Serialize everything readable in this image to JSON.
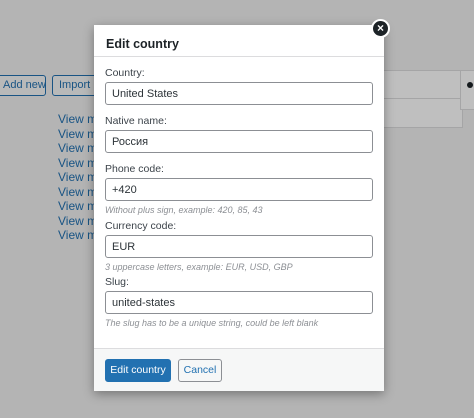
{
  "background": {
    "buttons": {
      "add_new": "Add new",
      "import": "Import r"
    },
    "links": [
      "View mo",
      "View mo",
      "View mo",
      "View mo",
      "View mo",
      "View mo",
      "View mo",
      "View mo",
      "View mo"
    ]
  },
  "modal": {
    "title": "Edit country",
    "close_icon": "×",
    "fields": {
      "country": {
        "label": "Country:",
        "value": "United States"
      },
      "native_name": {
        "label": "Native name:",
        "value": "Россия"
      },
      "phone_code": {
        "label": "Phone code:",
        "value": "+420",
        "help": "Without plus sign, example: 420, 85, 43"
      },
      "currency_code": {
        "label": "Currency code:",
        "value": "EUR",
        "help": "3 uppercase letters, example: EUR, USD, GBP"
      },
      "slug": {
        "label": "Slug:",
        "value": "united-states",
        "help": "The slug has to be a unique string, could be left blank"
      }
    },
    "buttons": {
      "submit": "Edit country",
      "cancel": "Cancel"
    }
  },
  "colors": {
    "accent": "#2271b1",
    "overlay": "rgba(0,0,0,0.25)"
  }
}
